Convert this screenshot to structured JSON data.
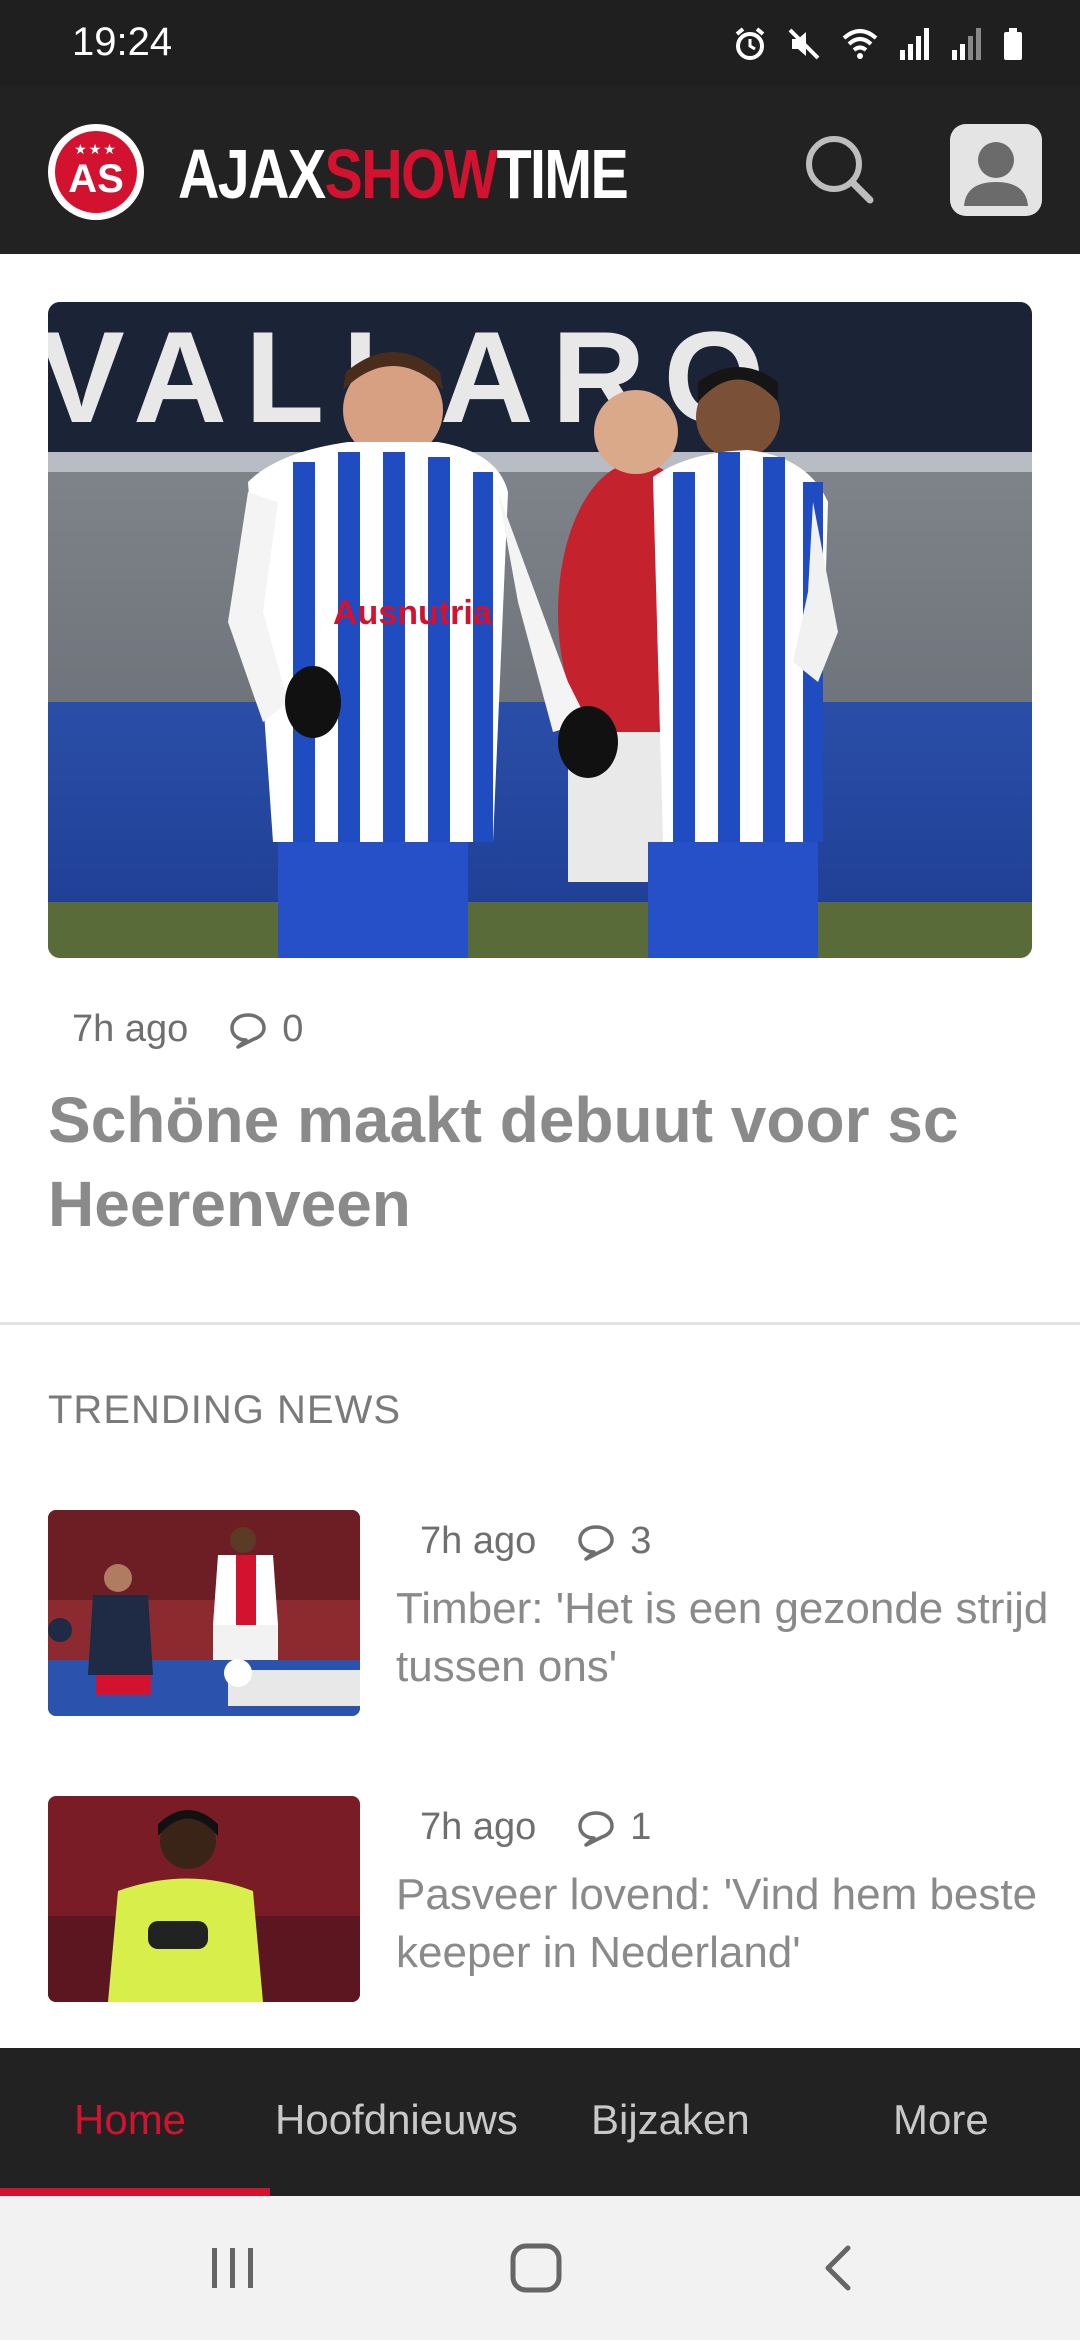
{
  "status_bar": {
    "time": "19:24",
    "icons": [
      "alarm-icon",
      "mute-icon",
      "wifi-icon",
      "signal-icon",
      "signal-icon-2",
      "battery-icon"
    ]
  },
  "header": {
    "logo_badge": "AS",
    "brand_part1": "AJAX",
    "brand_part2": "SHOW",
    "brand_part3": "TIME",
    "brand_color": "#d2122e"
  },
  "hero": {
    "time_ago": "7h ago",
    "comments": "0",
    "title": "Schöne maakt debuut voor sc Heerenveen",
    "image_banner_text": "VALLARO"
  },
  "trending": {
    "label": "TRENDING NEWS",
    "items": [
      {
        "time_ago": "7h ago",
        "comments": "3",
        "title": "Timber: 'Het is een gezonde strijd tussen ons'"
      },
      {
        "time_ago": "7h ago",
        "comments": "1",
        "title": "Pasveer lovend: 'Vind hem beste keeper in Nederland'"
      }
    ]
  },
  "bottom_nav": {
    "tabs": [
      {
        "label": "Home",
        "active": true
      },
      {
        "label": "Hoofdnieuws",
        "active": false
      },
      {
        "label": "Bijzaken",
        "active": false
      },
      {
        "label": "More",
        "active": false
      }
    ]
  },
  "system_nav": [
    "recents-icon",
    "home-icon",
    "back-icon"
  ]
}
